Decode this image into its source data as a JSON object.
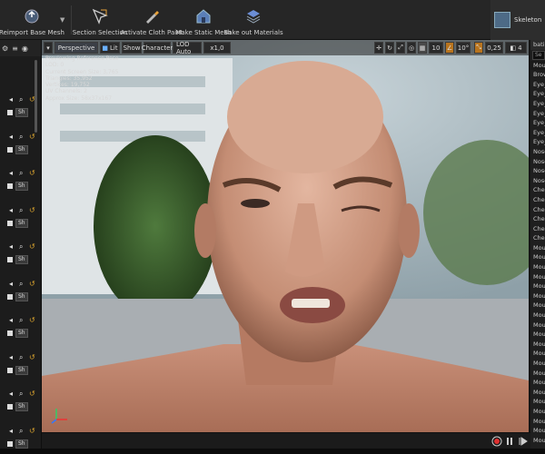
{
  "toolbar": {
    "reimport": "Reimport Base Mesh",
    "section": "Section Selection",
    "cloth": "Activate Cloth Paint",
    "static": "Make Static Mesh",
    "bake": "Bake out Materials",
    "skeleton": "Skeleton"
  },
  "viewport": {
    "perspective": "Perspective",
    "lit": "Lit",
    "show": "Show",
    "character": "Character",
    "lod": "LOD Auto",
    "speed": "x1,0",
    "grid": "10",
    "angle": "10°",
    "scale": "0,25",
    "cam": "4"
  },
  "hud": {
    "line1": "Previewing Reference Pose",
    "line2": "LOD: 0",
    "line3": "Current Screen Size: 3,765",
    "line4": "Triangles: 35,952",
    "line5": "Vertices: 19,752",
    "line6": "UV Channels: 2",
    "line7": "Approx Size: 58x37x167"
  },
  "left_panel": {
    "sh_label": "Sh"
  },
  "right_panel": {
    "header": "batin",
    "search": "Se",
    "items": [
      "Mou",
      "Brow",
      "Eye_",
      "Eye_",
      "Eye_",
      "Eye_",
      "Eye_",
      "Eye_",
      "Eye_",
      "Nose",
      "Nose",
      "Nose",
      "Nose",
      "Chee",
      "Chee",
      "Chee",
      "Chee",
      "Chee",
      "Chee",
      "Mou",
      "Mou",
      "Mou",
      "Mou",
      "Mou",
      "Mou",
      "Mou",
      "Mou",
      "Mou",
      "Mou",
      "Mou",
      "Mou",
      "Mou",
      "Mou",
      "Mou",
      "Mou",
      "Mou",
      "Mou",
      "Mou",
      "Mou",
      "Mou"
    ]
  }
}
